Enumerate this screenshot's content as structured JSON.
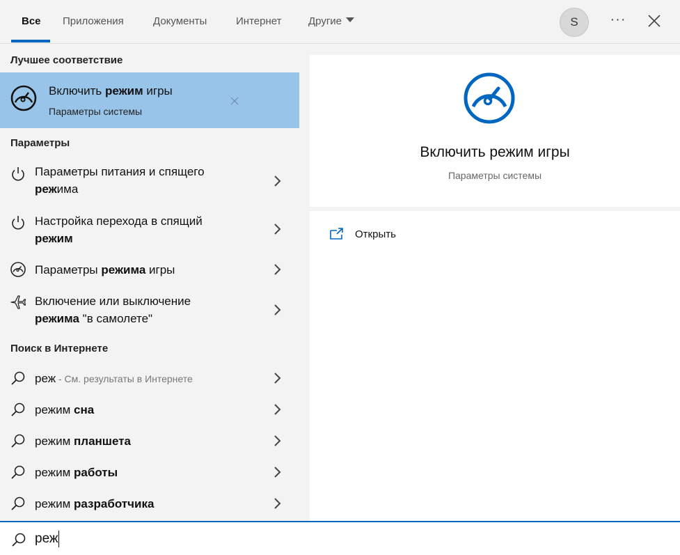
{
  "tabs": [
    {
      "label": "Все",
      "active": true
    },
    {
      "label": "Приложения"
    },
    {
      "label": "Документы"
    },
    {
      "label": "Интернет"
    },
    {
      "label": "Другие"
    }
  ],
  "header": {
    "avatar_letter": "S",
    "more_label": "···"
  },
  "best_match": {
    "heading": "Лучшее соответствие",
    "title_pre": "Включить ",
    "title_bold": "режим",
    "title_post": " игры",
    "subtitle": "Параметры системы",
    "icon": "gamemode-icon"
  },
  "settings": {
    "heading": "Параметры",
    "items": [
      {
        "icon": "power-icon",
        "line1_pre": "Параметры питания и спящего",
        "line1_bold": "",
        "line1_post": "",
        "line2_bold": "реж",
        "line2_post": "има"
      },
      {
        "icon": "power-icon",
        "line1_pre": "Настройка перехода в спящий",
        "line1_bold": "",
        "line1_post": "",
        "line2_bold": "режим",
        "line2_post": ""
      },
      {
        "icon": "gamemode-icon",
        "line1_pre": "Параметры ",
        "line1_bold": "режима",
        "line1_post": " игры",
        "line2_bold": "",
        "line2_post": ""
      },
      {
        "icon": "airplane-icon",
        "line1_pre": "Включение или выключение",
        "line1_bold": "",
        "line1_post": "",
        "line2_bold": "режима",
        "line2_post": " \"в самолете\""
      }
    ]
  },
  "web": {
    "heading": "Поиск в Интернете",
    "items": [
      {
        "plain": "реж",
        "bold": "",
        "hint": " - См. результаты в Интернете"
      },
      {
        "plain": "режим ",
        "bold": "сна",
        "hint": ""
      },
      {
        "plain": "режим ",
        "bold": "планшета",
        "hint": ""
      },
      {
        "plain": "режим ",
        "bold": "работы",
        "hint": ""
      },
      {
        "plain": "режим ",
        "bold": "разработчика",
        "hint": ""
      }
    ]
  },
  "preview": {
    "title": "Включить режим игры",
    "subtitle": "Параметры системы",
    "open_label": "Открыть"
  },
  "search": {
    "value": "реж"
  },
  "colors": {
    "accent": "#0067c0",
    "selected_bg": "#99c4e9",
    "pane_bg": "#f3f3f3"
  }
}
